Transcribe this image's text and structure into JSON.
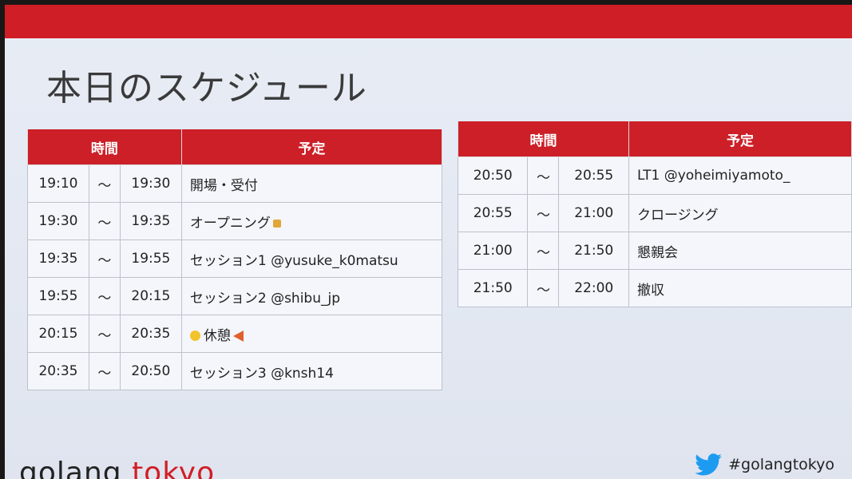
{
  "title": "本日のスケジュール",
  "headers": {
    "time": "時間",
    "plan": "予定"
  },
  "left_rows": [
    {
      "start": "19:10",
      "sep": "〜",
      "end": "19:30",
      "event": "開場・受付"
    },
    {
      "start": "19:30",
      "sep": "〜",
      "end": "19:35",
      "event": "オープニング"
    },
    {
      "start": "19:35",
      "sep": "〜",
      "end": "19:55",
      "event": "セッション1 @yusuke_k0matsu"
    },
    {
      "start": "19:55",
      "sep": "〜",
      "end": "20:15",
      "event": "セッション2 @shibu_jp"
    },
    {
      "start": "20:15",
      "sep": "〜",
      "end": "20:35",
      "event": "休憩"
    },
    {
      "start": "20:35",
      "sep": "〜",
      "end": "20:50",
      "event": "セッション3 @knsh14"
    }
  ],
  "right_rows": [
    {
      "start": "20:50",
      "sep": "〜",
      "end": "20:55",
      "event": "LT1 @yoheimiyamoto_"
    },
    {
      "start": "20:55",
      "sep": "〜",
      "end": "21:00",
      "event": "クロージング"
    },
    {
      "start": "21:00",
      "sep": "〜",
      "end": "21:50",
      "event": "懇親会"
    },
    {
      "start": "21:50",
      "sep": "〜",
      "end": "22:00",
      "event": "撤収"
    }
  ],
  "footer": {
    "logo_part1": "golang ",
    "logo_part2": "tokyo",
    "hashtag": "#golangtokyo"
  },
  "colors": {
    "accent": "#d01e26",
    "background": "#e7ecf5"
  }
}
